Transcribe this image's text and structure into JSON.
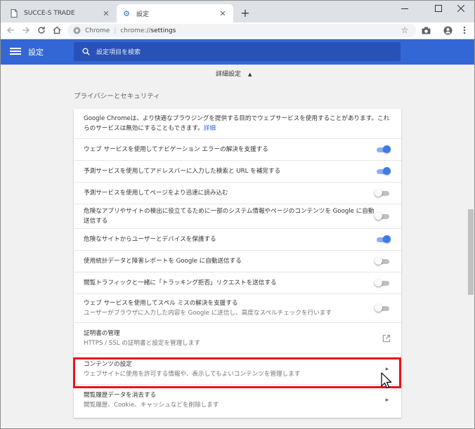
{
  "browser": {
    "tabs": [
      {
        "title": "SUCCE-S TRADE",
        "active": false
      },
      {
        "title": "設定",
        "active": true
      }
    ],
    "omnibox": {
      "site": "Chrome",
      "url_prefix": "chrome://",
      "url_path": "settings"
    }
  },
  "header": {
    "title": "設定",
    "search_placeholder": "設定項目を検索"
  },
  "advanced_link": "詳細設定",
  "section_title": "プライバシーとセキュリティ",
  "privacy": {
    "intro_text": "Google Chromeは、より快適なブラウジングを提供する目的でウェブサービスを使用することがあります。これらのサービスは無効にすることもできます。",
    "intro_link": "詳細",
    "rows": [
      {
        "label": "ウェブ サービスを使用してナビゲーション エラーの解決を支援する",
        "toggle": true
      },
      {
        "label": "予測サービスを使用してアドレスバーに入力した検索と URL を補完する",
        "toggle": true
      },
      {
        "label": "予測サービスを使用してページをより迅速に読み込む",
        "toggle": false
      },
      {
        "label": "危険なアプリやサイトの検出に役立てるために一部のシステム情報やページのコンテンツを Google に自動送信する",
        "toggle": false
      },
      {
        "label": "危険なサイトからユーザーとデバイスを保護する",
        "toggle": true
      },
      {
        "label": "使用統計データと障害レポートを Google に自動送信する",
        "toggle": false
      },
      {
        "label": "閲覧トラフィックと一緒に「トラッキング拒否」リクエストを送信する",
        "toggle": false
      },
      {
        "label": "ウェブ サービスを使用してスペル ミスの解決を支援する",
        "sub": "ユーザーがブラウザに入力した内容を Google に送信し、高度なスペルチェックを行います",
        "toggle": false
      }
    ],
    "certificates": {
      "label": "証明書の管理",
      "sub": "HTTPS / SSL の証明書と設定を管理します"
    },
    "content_settings": {
      "label": "コンテンツの設定",
      "sub": "ウェブサイトに使用を許可する情報や、表示してもよいコンテンツを管理します"
    },
    "clear_browsing": {
      "label": "閲覧履歴データを消去する",
      "sub": "閲覧履歴、Cookie、キャッシュなどを削除します"
    }
  },
  "colors": {
    "header_bg": "#3367d6",
    "toggle_on": "#3d7be8",
    "highlight": "#e8141a",
    "link": "#3367d6"
  }
}
